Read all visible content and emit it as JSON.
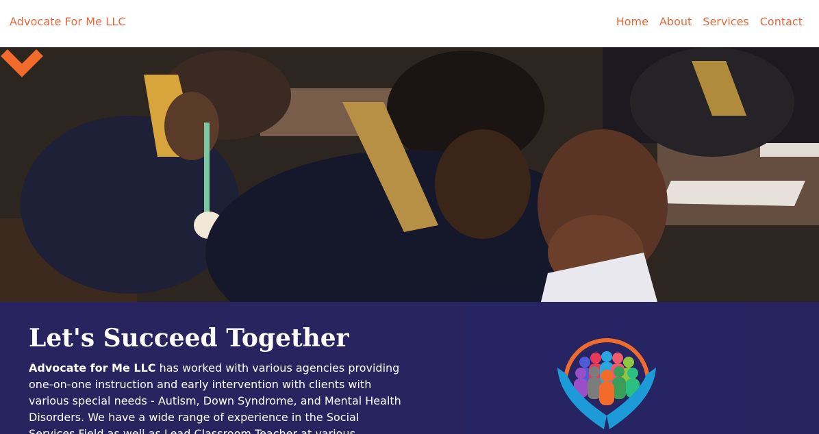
{
  "nav": {
    "brand": "Advocate For Me LLC",
    "items": [
      "Home",
      "About",
      "Services",
      "Contact"
    ]
  },
  "hero": {
    "scroll_icon": "chevron-down-icon",
    "accent_color": "#f26b2a"
  },
  "intro": {
    "title": "Let's Succeed Together",
    "company": "Advocate for Me LLC",
    "body": " has worked with various agencies providing one-on-one instruction and early intervention with clients with various special needs - Autism, Down Syndrome, and Mental Health Disorders. We have a wide range of experience in the Social Services Field as well as Lead Classroom Teacher at various"
  },
  "colors": {
    "brand": "#e5693a",
    "section_bg": "#27245f"
  }
}
